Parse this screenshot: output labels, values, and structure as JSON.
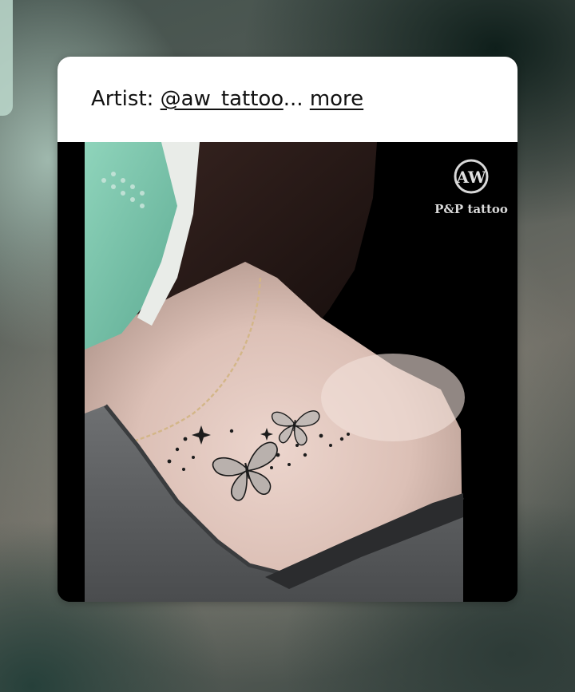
{
  "post": {
    "caption_prefix": "Artist: ",
    "artist_handle": "@aw_tattoo",
    "ellipsis": "...",
    "more_label": "more"
  },
  "photo": {
    "watermark_monogram": "AW",
    "watermark_text": "P&P tattoo",
    "subject": "butterfly-collarbone-tattoo-photo"
  },
  "colors": {
    "card_background": "#ffffff",
    "link_text": "#111111",
    "photo_background": "#000000"
  }
}
